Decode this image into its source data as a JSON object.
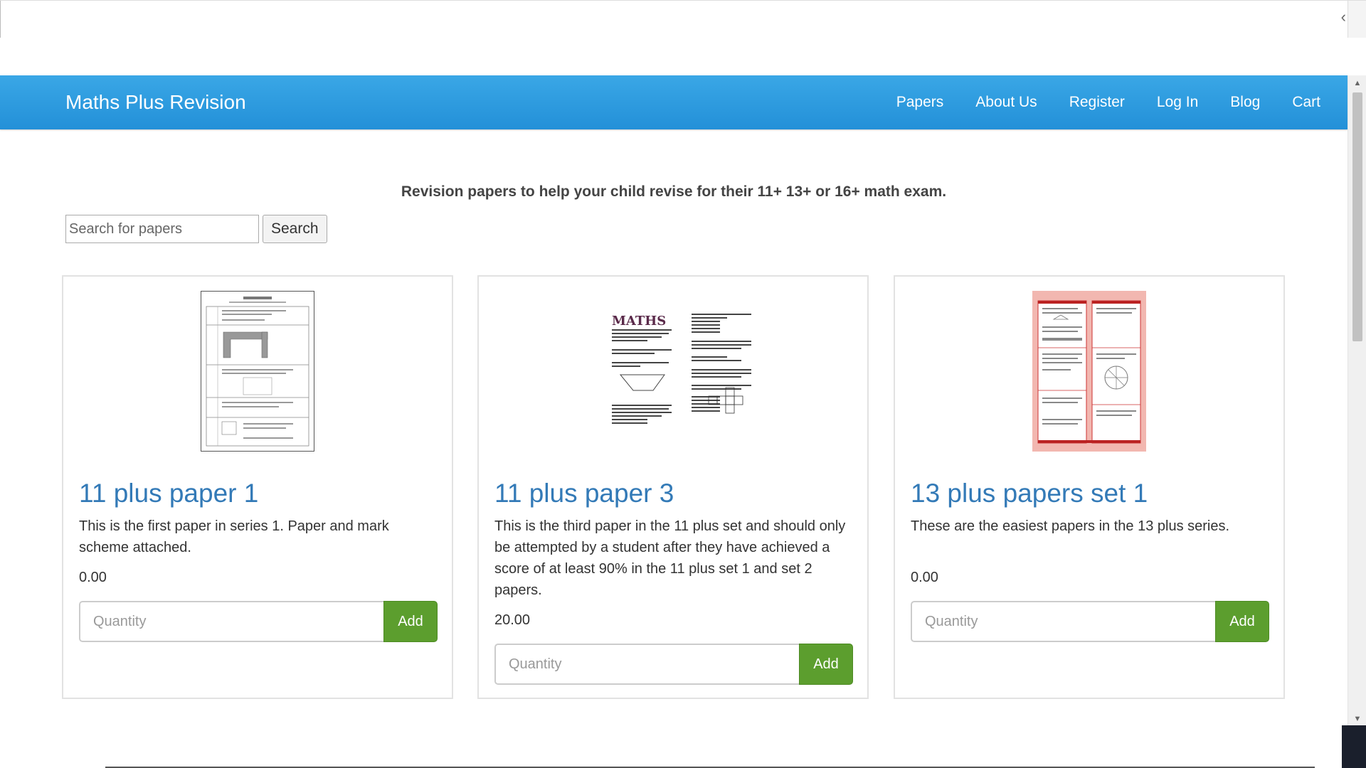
{
  "navbar": {
    "brand": "Maths Plus Revision",
    "links": [
      "Papers",
      "About Us",
      "Register",
      "Log In",
      "Blog",
      "Cart"
    ]
  },
  "tagline": "Revision papers to help your child revise for their 11+ 13+ or 16+ math exam.",
  "search": {
    "placeholder": "Search for papers",
    "button_label": "Search"
  },
  "products": [
    {
      "title": "11 plus paper 1",
      "description": "This is the first paper in series 1. Paper and mark scheme attached.",
      "price": "0.00",
      "quantity_placeholder": "Quantity",
      "add_label": "Add"
    },
    {
      "title": "11 plus paper 3",
      "description": "This is the third paper in the 11 plus set and should only be attempted by a student after they have achieved a score of at least 90% in the 11 plus set 1 and set 2 papers.",
      "price": "20.00",
      "quantity_placeholder": "Quantity",
      "add_label": "Add",
      "thumbnail_heading": "MATHS"
    },
    {
      "title": "13 plus papers set 1",
      "description": "These are the easiest papers in the 13 plus series.",
      "price": "0.00",
      "quantity_placeholder": "Quantity",
      "add_label": "Add"
    }
  ],
  "colors": {
    "navbar": "#2b9be0",
    "link": "#337ab7",
    "add_button": "#5c9e2e"
  }
}
